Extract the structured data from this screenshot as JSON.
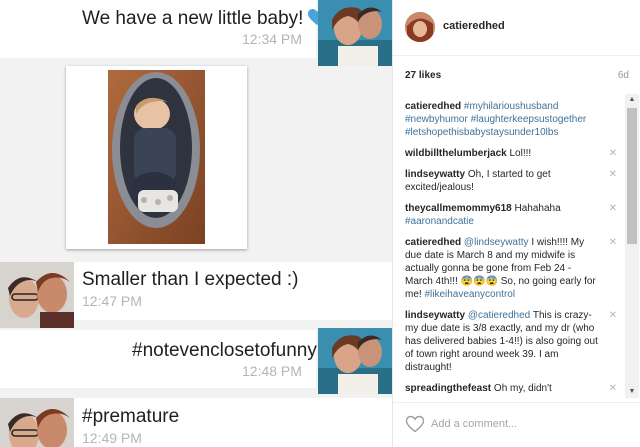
{
  "chat": {
    "messages": [
      {
        "text": "We have a new little baby!",
        "time": "12:34 PM",
        "side": "right",
        "emoji": "blue-heart"
      },
      {
        "type": "photo",
        "side": "left"
      },
      {
        "text": "Smaller than I expected :)",
        "time": "12:47 PM",
        "side": "left"
      },
      {
        "text": "#noteven closetofunny",
        "display": "#notevenclosetofunny",
        "time": "12:48 PM",
        "side": "right"
      },
      {
        "text": "#premature",
        "time": "12:49 PM",
        "side": "left"
      }
    ]
  },
  "post": {
    "username": "catieredhed",
    "likes": "27 likes",
    "age": "6d",
    "caption": {
      "user": "catieredhed",
      "tags": [
        "#myhilarioushusband",
        "#newbyhumor",
        "#laughterkeepsustogether",
        "#letshopethisbabystaysunder10lbs"
      ]
    },
    "comments": [
      {
        "user": "wildbillthelumberjack",
        "parts": [
          "Lol!!!"
        ]
      },
      {
        "user": "lindseywatty",
        "parts": [
          "Oh, I started to get excited/jealous!"
        ]
      },
      {
        "user": "theycallmemommy618",
        "parts": [
          "Hahahaha "
        ],
        "tag": "#aaronandcatie"
      },
      {
        "user": "catieredhed",
        "mention": "@lindseywatty",
        "parts": [
          " I wish!!!! My due date is March 8 and my midwife is actually gonna be gone from Feb 24 - March 4th!!! 😨😨😨 So, no going early for me! "
        ],
        "tag": "#likeihaveanycontrol"
      },
      {
        "user": "lindseywatty",
        "mention": "@catieredhed",
        "parts": [
          " This is crazy- my due date is 3/8 exactly, and my dr (who has delivered babies 1-4!!) is also going out of town right around week 39. I am distraught!"
        ]
      },
      {
        "user": "spreadingthefeast",
        "parts": [
          "Oh my, didn't"
        ]
      }
    ],
    "comment_placeholder": "Add a comment..."
  },
  "colors": {
    "chat_bg": "#f2f2f2",
    "bubble": "#ffffff",
    "timestamp": "#b5b5b5",
    "heart_emoji": "#4ba3d9",
    "hashtag": "#3f729b"
  }
}
